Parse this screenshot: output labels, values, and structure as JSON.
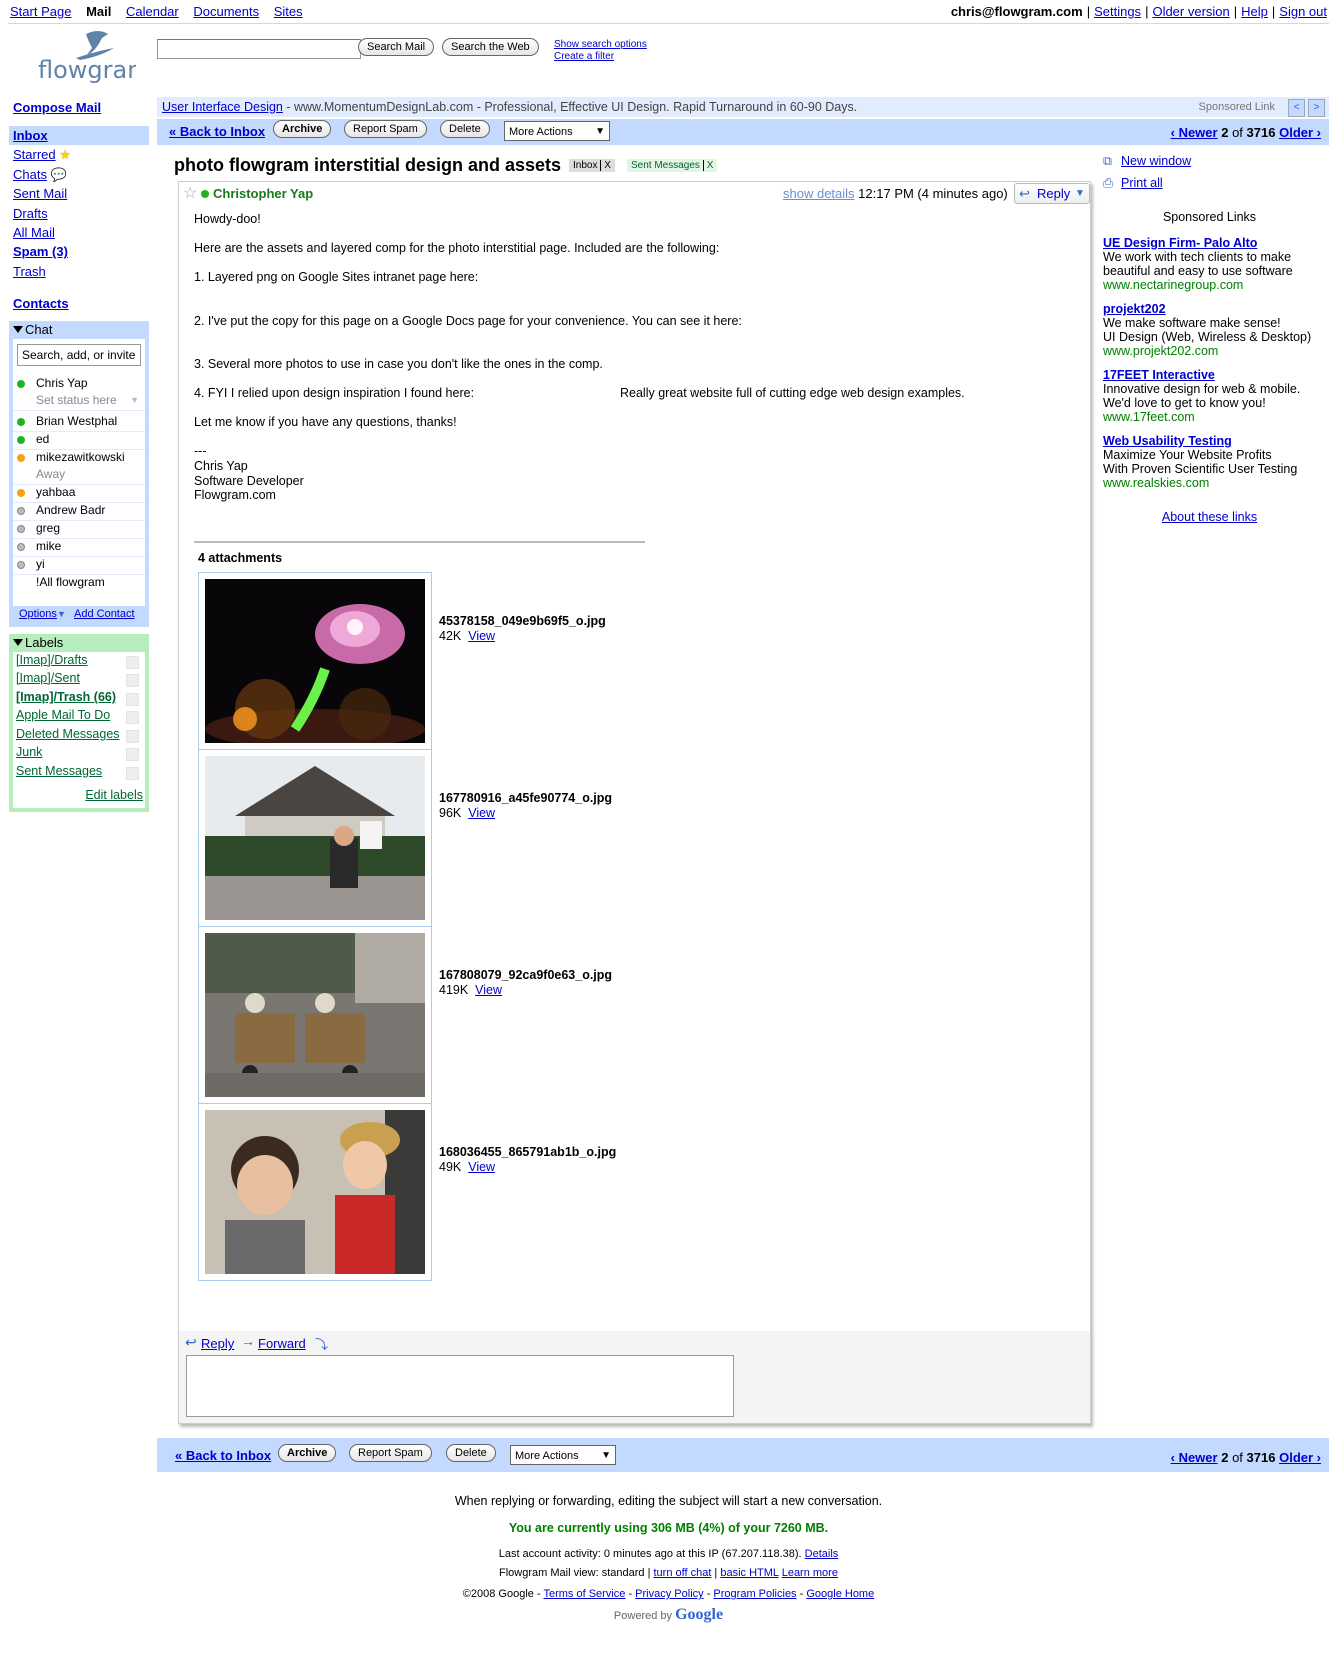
{
  "top_nav": {
    "items": [
      "Start Page",
      "Mail",
      "Calendar",
      "Documents",
      "Sites"
    ],
    "user": "chris@flowgram.com",
    "links": [
      "Settings",
      "Older version",
      "Help",
      "Sign out"
    ]
  },
  "logo": {
    "text": "flowgram"
  },
  "search": {
    "value": "",
    "search_mail": "Search Mail",
    "search_web": "Search the Web",
    "show_options": "Show search options",
    "create_filter": "Create a filter"
  },
  "sidebar": {
    "compose": "Compose Mail",
    "items": [
      "Inbox",
      "Starred",
      "Chats",
      "Sent Mail",
      "Drafts",
      "All Mail",
      "Spam (3)",
      "Trash"
    ],
    "contacts": "Contacts"
  },
  "chat": {
    "header": "Chat",
    "search_placeholder": "Search, add, or invite",
    "me": "Chris Yap",
    "status": "Set status here",
    "contacts": [
      {
        "name": "Brian Westphal",
        "status": "online"
      },
      {
        "name": "ed",
        "status": "online"
      },
      {
        "name": "mikezawitkowski",
        "status": "away"
      },
      {
        "name": "Away",
        "status": "note"
      },
      {
        "name": "yahbaa",
        "status": "away"
      },
      {
        "name": "Andrew Badr",
        "status": "offline"
      },
      {
        "name": "greg",
        "status": "offline"
      },
      {
        "name": "mike",
        "status": "offline"
      },
      {
        "name": "yi",
        "status": "offline"
      },
      {
        "name": "!All flowgram",
        "status": "group"
      }
    ],
    "options": "Options",
    "add_contact": "Add Contact"
  },
  "labels": {
    "header": "Labels",
    "items": [
      "[Imap]/Drafts",
      "[Imap]/Sent",
      "[Imap]/Trash (66)",
      "Apple Mail To Do",
      "Deleted Messages",
      "Junk",
      "Sent Messages"
    ],
    "edit": "Edit labels"
  },
  "ad_bar": {
    "link": "User Interface Design",
    "text": " - www.MomentumDesignLab.com - Professional, Effective UI Design. Rapid Turnaround in 60-90 Days.",
    "sponsored": "Sponsored Link"
  },
  "toolbar": {
    "back": "« Back to Inbox",
    "archive": "Archive",
    "report_spam": "Report Spam",
    "delete": "Delete",
    "more_actions": "More Actions",
    "newer": "‹ Newer",
    "position": "2",
    "of": "of",
    "total": "3716",
    "older": "Older ›"
  },
  "message": {
    "subject": "photo flowgram interstitial design and assets",
    "tags": [
      "Inbox",
      "Sent Messages"
    ],
    "sender": "Christopher Yap",
    "show_details": "show details",
    "time": "12:17 PM (4 minutes ago)",
    "reply": "Reply",
    "body": [
      "Howdy-doo!",
      "Here are the assets and layered comp for the photo interstitial page.  Included are the following:",
      "1. Layered png on Google Sites intranet page here:",
      "2. I've put the copy for this page on a Google Docs page for your convenience.  You can see it here:",
      "3. Several more photos to use in case you don't like the ones in the comp.",
      "4. FYI I relied upon design inspiration I found here:",
      "Really great website full of cutting edge web design examples.",
      "Let me know if you have any questions, thanks!",
      "---",
      "Chris Yap",
      "Software Developer",
      "Flowgram.com"
    ],
    "attachments_title": "4 attachments",
    "attachments": [
      {
        "name": "45378158_049e9b69f5_o.jpg",
        "size": "42K",
        "view": "View"
      },
      {
        "name": "167780916_a45fe90774_o.jpg",
        "size": "96K",
        "view": "View"
      },
      {
        "name": "167808079_92ca9f0e63_o.jpg",
        "size": "419K",
        "view": "View"
      },
      {
        "name": "168036455_865791ab1b_o.jpg",
        "size": "49K",
        "view": "View"
      }
    ],
    "reply_link": "Reply",
    "forward_link": "Forward"
  },
  "right": {
    "new_window": "New window",
    "print_all": "Print all",
    "sponsored": "Sponsored Links",
    "ads": [
      {
        "title": "UE Design Firm- Palo Alto",
        "lines": [
          "We work with tech clients to make",
          "beautiful and easy to use software"
        ],
        "url": "www.nectarinegroup.com"
      },
      {
        "title": "projekt202",
        "lines": [
          "We make software make sense!",
          "UI Design (Web, Wireless & Desktop)"
        ],
        "url": "www.projekt202.com"
      },
      {
        "title": "17FEET Interactive",
        "lines": [
          "Innovative design for web & mobile.",
          "We'd love to get to know you!"
        ],
        "url": "www.17feet.com"
      },
      {
        "title": "Web Usability Testing",
        "lines": [
          "Maximize Your Website Profits",
          "With Proven Scientific User Testing"
        ],
        "url": "www.realskies.com"
      }
    ],
    "about": "About these links"
  },
  "footer": {
    "note": "When replying or forwarding, editing the subject will start a new conversation.",
    "usage": "You are currently using 306 MB (4%) of your 7260 MB.",
    "activity": "Last account activity: 0 minutes ago at this IP (67.207.118.38).",
    "details": "Details",
    "view": "Flowgram Mail view: standard |",
    "turn_off_chat": "turn off chat",
    "basic_html": "basic HTML",
    "learn_more": "Learn more",
    "copyright": "©2008 Google -",
    "tos": "Terms of Service",
    "privacy": "Privacy Policy",
    "program": "Program Policies",
    "home": "Google Home",
    "powered": "Powered by",
    "google": "Google"
  },
  "colors": {
    "nav_blue": "#c3d9ff",
    "label_green": "#b5edbc",
    "link": "#0000cc",
    "sender_green": "#1a7a1a",
    "ad_url": "#008000"
  }
}
